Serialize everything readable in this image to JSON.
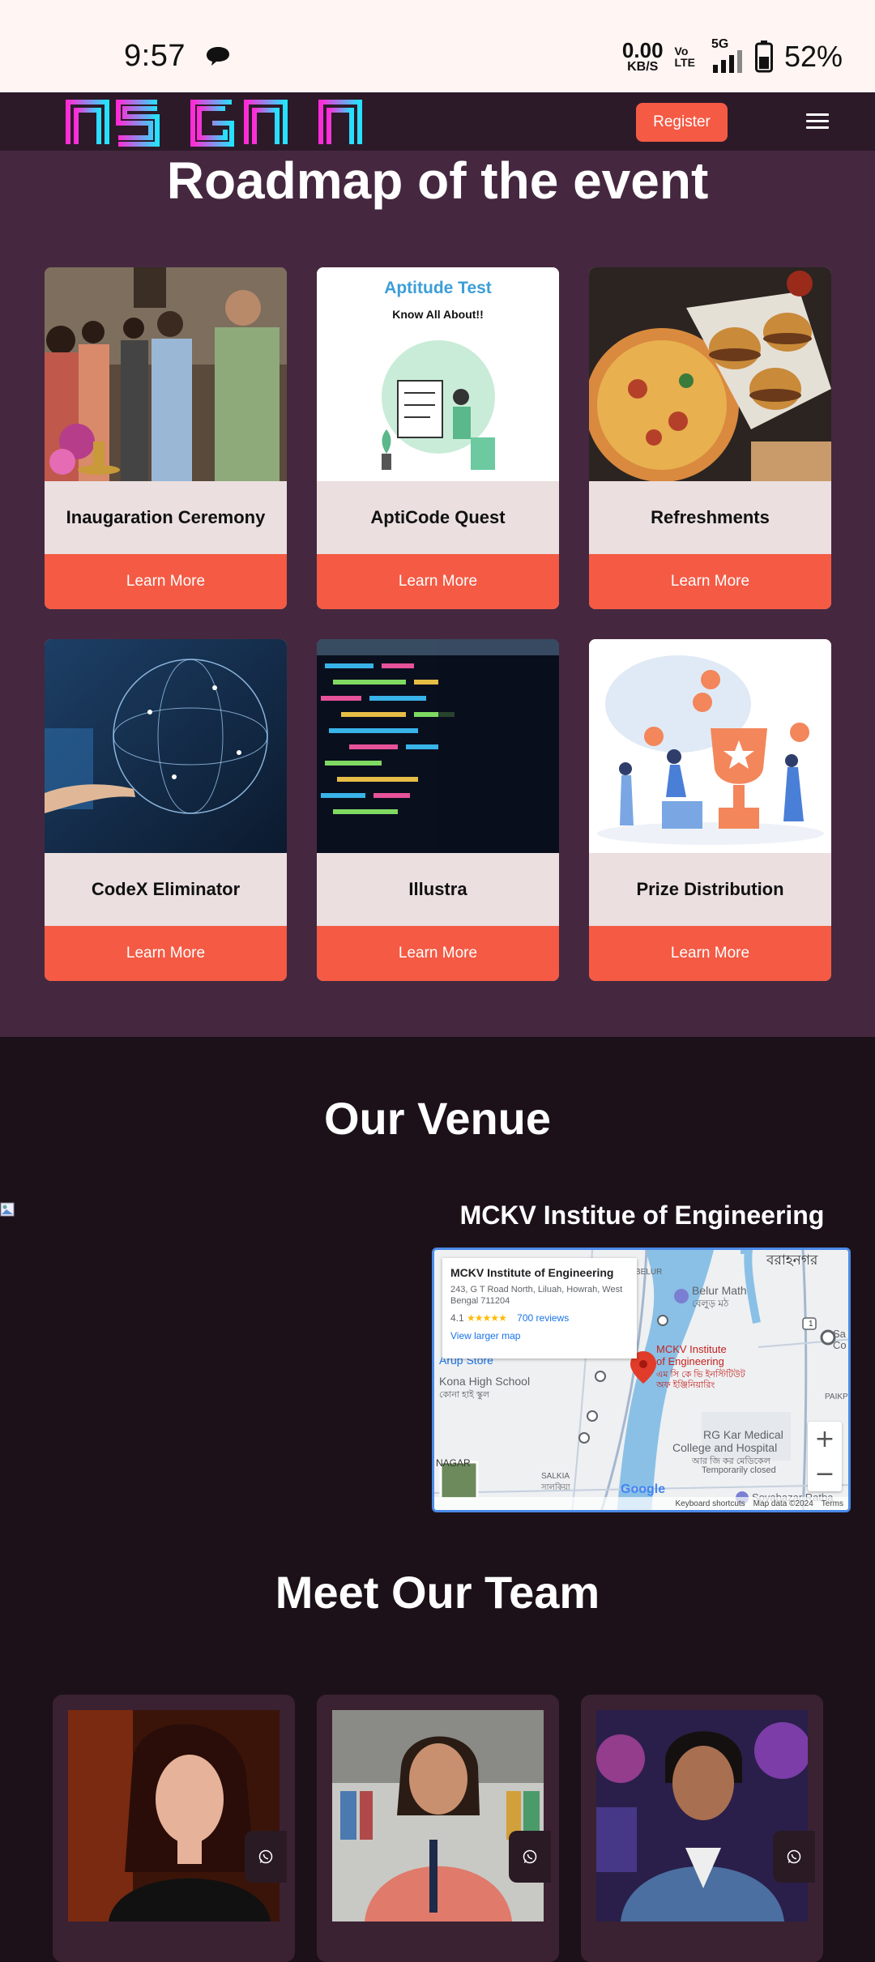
{
  "status_bar": {
    "time": "9:57",
    "speed_value": "0.00",
    "speed_unit": "KB/S",
    "volte_1": "Vo",
    "volte_2": "LTE",
    "network": "5G",
    "battery": "52%"
  },
  "nav": {
    "logo_text": "INSIGNIA",
    "register_label": "Register"
  },
  "roadmap": {
    "title": "Roadmap of the event",
    "cards": [
      {
        "title": "Inaugaration Ceremony",
        "button": "Learn More"
      },
      {
        "title": "AptiCode Quest",
        "button": "Learn More",
        "image_heading": "Aptitude Test",
        "image_subheading": "Know All About!!"
      },
      {
        "title": "Refreshments",
        "button": "Learn More"
      },
      {
        "title": "CodeX Eliminator",
        "button": "Learn More"
      },
      {
        "title": "Illustra",
        "button": "Learn More"
      },
      {
        "title": "Prize Distribution",
        "button": "Learn More"
      }
    ]
  },
  "venue": {
    "title": "Our Venue",
    "name": "MCKV Institue of Engineering",
    "map": {
      "place_name": "MCKV Institute of Engineering",
      "address": "243, G T Road North, Liluah, Howrah, West Bengal 711204",
      "rating": "4.1",
      "stars": "★★★★★",
      "reviews": "700 reviews",
      "larger_map_link": "View larger map",
      "zoom_in": "+",
      "zoom_out": "−",
      "labels": {
        "belur_math": "Belur Math",
        "belur_math_bn": "বেলুড় মঠ",
        "baranagar_bn": "বরাহনগর",
        "belur": "BELUR",
        "arup_store": "Arup Store",
        "kona_school": "Kona High School",
        "kona_school_bn": "কোনা হাই স্কুল",
        "pin_label_1": "MCKV Institute",
        "pin_label_2": "of Engineering",
        "pin_label_bn_1": "এম সি কে ভি ইনস্টিটিউট",
        "pin_label_bn_2": "অফ ইঞ্জিনিয়ারিং",
        "rg_kar_1": "RG Kar Medical",
        "rg_kar_2": "College and Hospital",
        "rg_kar_bn": "আর জি কর মেডিকেল",
        "temp_closed": "Temporarily closed",
        "sovabazar": "Sovabazar Ratba",
        "salkia": "SALKIA",
        "salkia_bn": "সালকিয়া",
        "nagar": "NAGAR",
        "paik": "PAIKP",
        "road_no": "1"
      },
      "google": "Google",
      "footer": [
        "Keyboard shortcuts",
        "Map data ©2024",
        "Terms"
      ]
    }
  },
  "team": {
    "title": "Meet Our Team",
    "members": [
      {
        "photo": "team-member-1"
      },
      {
        "photo": "team-member-2"
      },
      {
        "photo": "team-member-3"
      }
    ]
  }
}
